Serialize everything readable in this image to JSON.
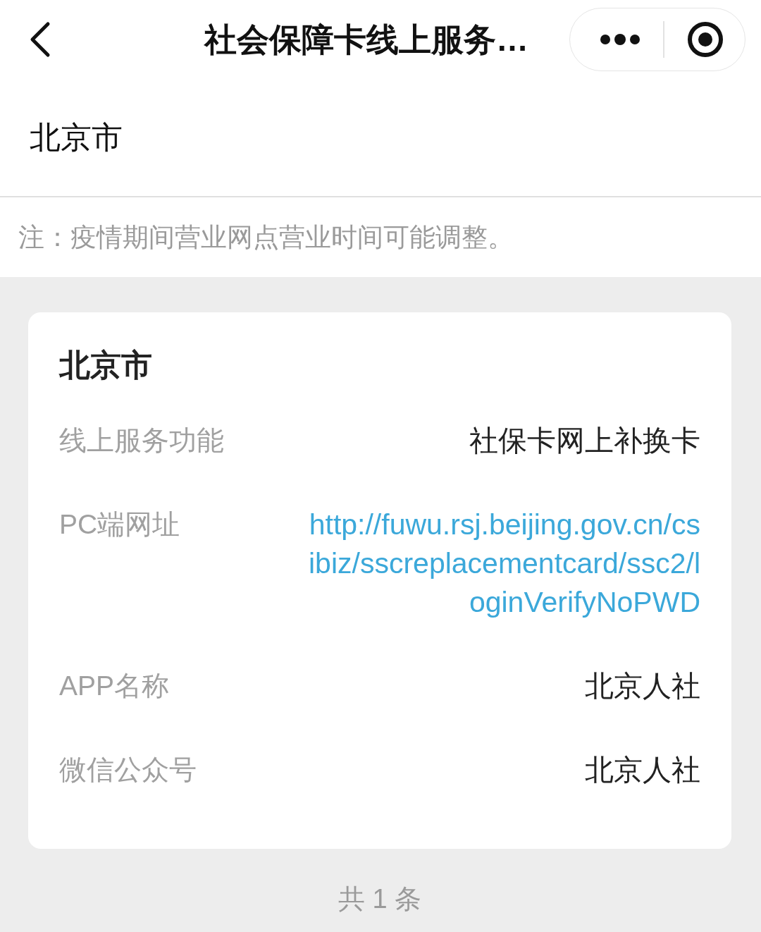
{
  "nav_bar": {
    "title": "社会保障卡线上服务…"
  },
  "city_selector": {
    "value": "北京市"
  },
  "notice": "注：疫情期间营业网点营业时间可能调整。",
  "card": {
    "title": "北京市",
    "rows": [
      {
        "label": "线上服务功能",
        "value": "社保卡网上补换卡",
        "kind": "text"
      },
      {
        "label": "PC端网址",
        "value": "http://fuwu.rsj.beijing.gov.cn/csibiz/sscreplacementcard/ssc2/loginVerifyNoPWD",
        "kind": "link"
      },
      {
        "label": "APP名称",
        "value": "北京人社",
        "kind": "text"
      },
      {
        "label": "微信公众号",
        "value": "北京人社",
        "kind": "text"
      }
    ]
  },
  "footer": "共 1 条"
}
